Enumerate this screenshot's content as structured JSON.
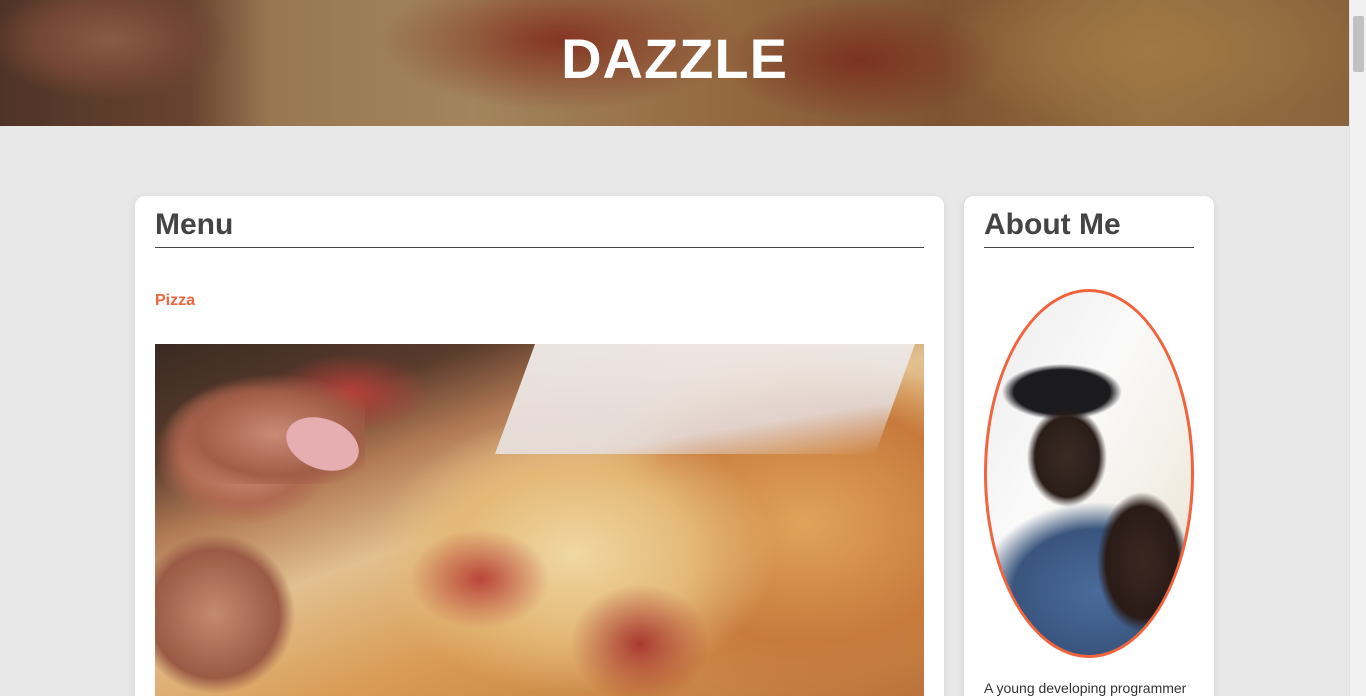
{
  "header": {
    "title": "DAZZLE"
  },
  "menu_section": {
    "heading": "Menu",
    "category": "Pizza",
    "image_alt": "pizza-photo"
  },
  "about_section": {
    "heading": "About Me",
    "bio": "A young developing programmer"
  },
  "colors": {
    "accent": "#f0643e",
    "background": "#e8e8e8",
    "card": "#ffffff",
    "heading_text": "#444444"
  }
}
